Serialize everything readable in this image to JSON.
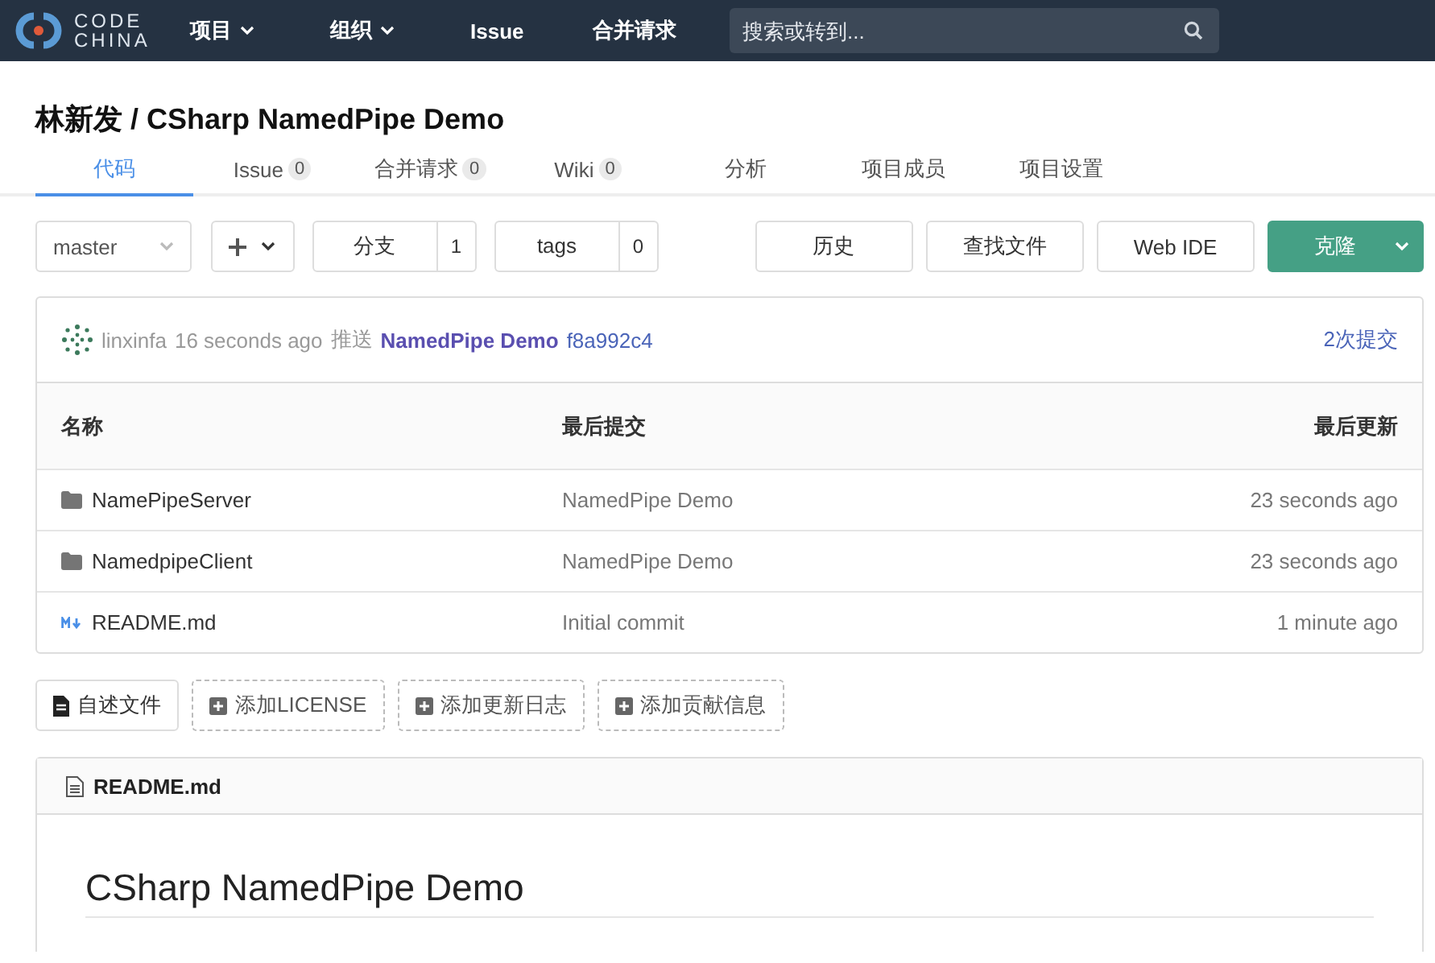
{
  "header": {
    "logo": [
      "CODE",
      "CHINA"
    ],
    "nav": [
      {
        "label": "项目",
        "dropdown": true
      },
      {
        "label": "组织",
        "dropdown": true
      },
      {
        "label": "Issue",
        "dropdown": false
      },
      {
        "label": "合并请求",
        "dropdown": false
      }
    ],
    "search": {
      "placeholder": "搜索或转到..."
    }
  },
  "repo": {
    "owner": "林新发",
    "separator": "/",
    "name": "CSharp NamedPipe Demo"
  },
  "tabs": [
    {
      "label": "代码",
      "selected": true
    },
    {
      "label": "Issue",
      "count": "0",
      "selected": false
    },
    {
      "label": "合并请求",
      "count": "0",
      "selected": false
    },
    {
      "label": "Wiki",
      "count": "0",
      "selected": false
    },
    {
      "label": "分析",
      "selected": false
    },
    {
      "label": "项目成员",
      "selected": false
    },
    {
      "label": "项目设置",
      "selected": false
    }
  ],
  "toolbar": {
    "branch": "master",
    "branches": {
      "label": "分支",
      "count": "1"
    },
    "tags": {
      "label": "tags",
      "count": "0"
    },
    "buttons": [
      "历史",
      "查找文件",
      "Web IDE"
    ],
    "clone": "克隆"
  },
  "commit": {
    "author": "linxinfa",
    "time": "16 seconds ago",
    "action": "推送",
    "message": "NamedPipe Demo",
    "hash": "f8a992c4",
    "count": "2次提交"
  },
  "table": {
    "columns": [
      "名称",
      "最后提交",
      "最后更新"
    ],
    "rows": [
      {
        "kind": "folder",
        "name": "NamePipeServer",
        "commit": "NamedPipe Demo",
        "updated": "23 seconds ago"
      },
      {
        "kind": "folder",
        "name": "NamedpipeClient",
        "commit": "NamedPipe Demo",
        "updated": "23 seconds ago"
      },
      {
        "kind": "markdown",
        "name": "README.md",
        "commit": "Initial commit",
        "updated": "1 minute ago"
      }
    ]
  },
  "file_actions": [
    {
      "label": "自述文件",
      "kind": "existing"
    },
    {
      "label": "添加LICENSE",
      "kind": "add"
    },
    {
      "label": "添加更新日志",
      "kind": "add"
    },
    {
      "label": "添加贡献信息",
      "kind": "add"
    }
  ],
  "readme": {
    "filename": "README.md",
    "heading": "CSharp NamedPipe Demo"
  }
}
